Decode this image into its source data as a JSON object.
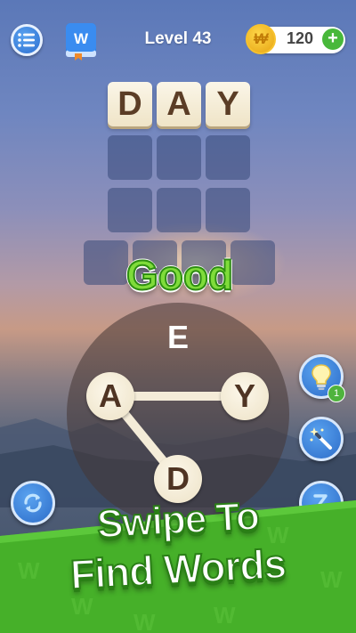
{
  "header": {
    "level_label": "Level 43",
    "coins": "120",
    "plus_label": "+",
    "book_letter": "W",
    "coin_symbol": "₩"
  },
  "grid": {
    "rows": [
      [
        "D",
        "A",
        "Y"
      ],
      [
        "",
        "",
        ""
      ],
      [
        "",
        "",
        ""
      ],
      [
        "",
        "",
        "",
        ""
      ]
    ]
  },
  "feedback": "Good",
  "wheel": {
    "letters": [
      "E",
      "A",
      "Y",
      "D"
    ],
    "selected": [
      "A",
      "Y",
      "D"
    ]
  },
  "buttons": {
    "hint_count": "1",
    "icons": [
      "menu-icon",
      "book-icon",
      "coin-icon",
      "plus-icon",
      "hint-bulb-icon",
      "magic-wand-icon",
      "shuffle-icon",
      "sort-icon"
    ]
  },
  "banner": {
    "line1": "Swipe To",
    "line2": "Find Words"
  },
  "colors": {
    "accent_blue": "#2d6fd0",
    "tile_brown": "#5b3d26",
    "good_green": "#7fdc3a",
    "banner_green": "#46b029"
  }
}
